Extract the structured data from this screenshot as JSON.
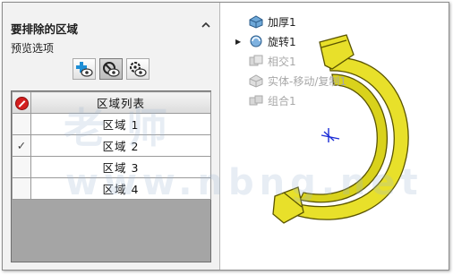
{
  "panel": {
    "title": "要排除的区域",
    "collapse_icon": "chevron-up-icon",
    "preview_label": "预览选项",
    "buttons": [
      {
        "name": "show-preview-button",
        "icon": "plus-eye-icon"
      },
      {
        "name": "hide-preview-button",
        "icon": "no-eye-icon",
        "active": true
      },
      {
        "name": "show-excluded-button",
        "icon": "gear-eye-icon"
      }
    ]
  },
  "region_table": {
    "header_icon": "exclude-icon",
    "header": "区域列表",
    "rows": [
      {
        "checked": "",
        "name": "区域 1"
      },
      {
        "checked": "✓",
        "name": "区域 2"
      },
      {
        "checked": "",
        "name": "区域 3"
      },
      {
        "checked": "",
        "name": "区域 4"
      }
    ]
  },
  "feature_tree": [
    {
      "label": "加厚1",
      "icon": "thicken-feature-icon",
      "dim": false
    },
    {
      "label": "旋转1",
      "icon": "revolve-feature-icon",
      "dim": false,
      "expander": "▶"
    },
    {
      "label": "相交1",
      "icon": "intersect-feature-icon",
      "dim": true
    },
    {
      "label": "实体-移动/复制1",
      "icon": "move-copy-body-icon",
      "dim": true
    },
    {
      "label": "组合1",
      "icon": "combine-feature-icon",
      "dim": true
    }
  ],
  "watermark": {
    "line1": "老 师",
    "line2": "www.nbng.net"
  },
  "colors": {
    "model_yellow": "#e8e02a",
    "exclude_red": "#d41e1e",
    "panel_bg": "#f2f2f2"
  }
}
